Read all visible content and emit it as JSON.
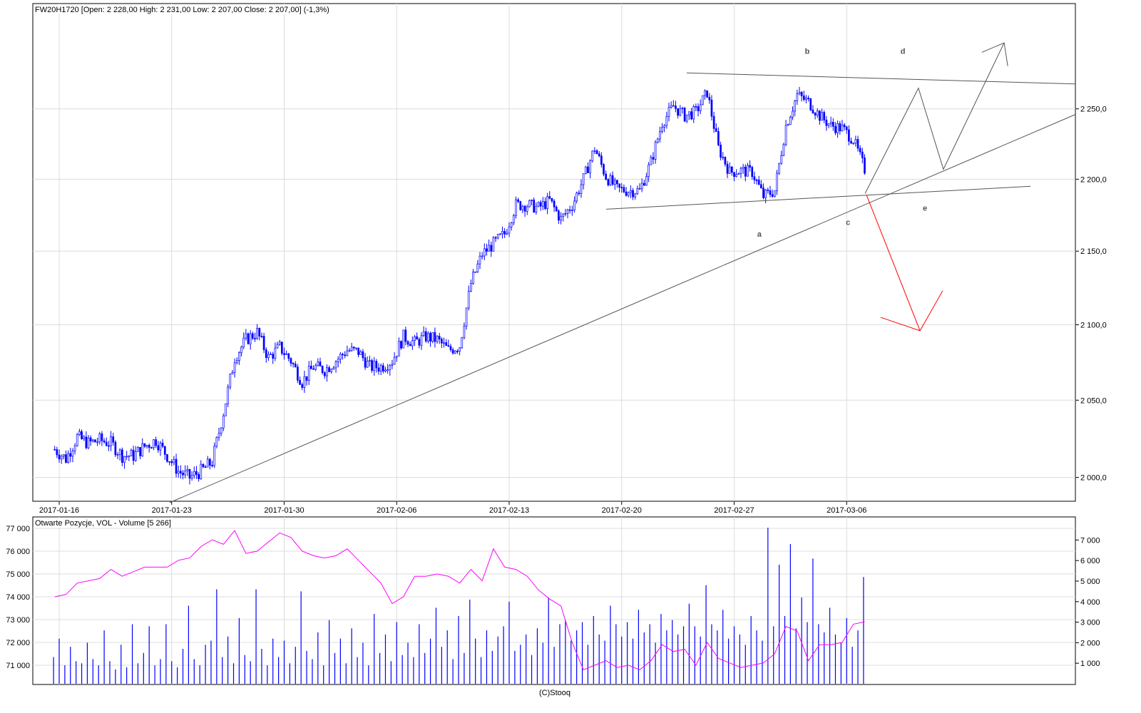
{
  "header": {
    "title": "FW20H1720 [Open: 2 228,00  High: 2 231,00  Low: 2 207,00  Close: 2 207,00] (-1,3%)"
  },
  "footer": {
    "credit": "(C)Stooq"
  },
  "colors": {
    "candle": "#0000ff",
    "volume": "#0000ff",
    "open_interest": "#ff00ff",
    "trendline": "#555555",
    "bear_arrow": "#ff0000",
    "grid": "#dcdcdc"
  },
  "chart_data": [
    {
      "type": "candlestick",
      "title": "FW20H1720 [Open: 2 228,00  High: 2 231,00  Low: 2 207,00  Close: 2 207,00] (-1,3%)",
      "x_unit": "trading days since 2017-01-16",
      "x_start": -0.2,
      "x_step": 0.5,
      "close": [
        2018,
        2012,
        2026,
        2022,
        2024,
        2022,
        2014,
        2014,
        2020,
        2024,
        2014,
        2004,
        2000,
        2004,
        2010,
        2042,
        2078,
        2090,
        2095,
        2078,
        2085,
        2076,
        2062,
        2072,
        2070,
        2076,
        2083,
        2082,
        2072,
        2072,
        2076,
        2092,
        2088,
        2092,
        2090,
        2083,
        2086,
        2128,
        2148,
        2155,
        2162,
        2182,
        2182,
        2180,
        2185,
        2172,
        2182,
        2200,
        2222,
        2202,
        2193,
        2192,
        2192,
        2212,
        2240,
        2252,
        2245,
        2248,
        2262,
        2222,
        2205,
        2206,
        2205,
        2188,
        2192,
        2238,
        2260,
        2255,
        2245,
        2238,
        2236,
        2228,
        2207
      ],
      "x_ticks": [
        {
          "day": 0,
          "label": "2017-01-16"
        },
        {
          "day": 5,
          "label": "2017-01-23"
        },
        {
          "day": 10,
          "label": "2017-01-30"
        },
        {
          "day": 15,
          "label": "2017-02-06"
        },
        {
          "day": 20,
          "label": "2017-02-13"
        },
        {
          "day": 25,
          "label": "2017-02-20"
        },
        {
          "day": 30,
          "label": "2017-02-27"
        },
        {
          "day": 35,
          "label": "2017-03-06"
        }
      ],
      "y_ticks": [
        {
          "value": 2000,
          "label": "2 000,0"
        },
        {
          "value": 2050,
          "label": "2 050,0"
        },
        {
          "value": 2100,
          "label": "2 100,0"
        },
        {
          "value": 2150,
          "label": "2 150,0"
        },
        {
          "value": 2200,
          "label": "2 200,0"
        },
        {
          "value": 2250,
          "label": "2 250,0"
        }
      ],
      "ylim": [
        1984,
        2310
      ],
      "y_scale": "log",
      "grid": true,
      "annotations": {
        "lines": [
          {
            "name": "long-support-trendline",
            "color": "trendline",
            "points": [
              [
                4.91,
                1984
              ],
              [
                45.17,
                2246
              ]
            ]
          },
          {
            "name": "upper-resistance-line",
            "color": "trendline",
            "points": [
              [
                27.89,
                2276
              ],
              [
                45.17,
                2268
              ]
            ]
          },
          {
            "name": "lower-triangle-line",
            "color": "trendline",
            "points": [
              [
                24.31,
                2179
              ],
              [
                43.17,
                2195
              ]
            ]
          },
          {
            "name": "bull-projection-path",
            "color": "trendline",
            "points": [
              [
                35.82,
                2190
              ],
              [
                38.19,
                2265
              ],
              [
                39.3,
                2207
              ],
              [
                42.0,
                2298
              ]
            ]
          },
          {
            "name": "bull-arrow-head",
            "color": "trendline",
            "points": [
              [
                41.01,
                2291
              ],
              [
                42.0,
                2298
              ],
              [
                42.16,
                2281
              ]
            ]
          },
          {
            "name": "bear-projection-path",
            "color": "bear_arrow",
            "points": [
              [
                35.88,
                2189
              ],
              [
                38.26,
                2096
              ]
            ]
          },
          {
            "name": "bear-arrow-head",
            "color": "bear_arrow",
            "points": [
              [
                36.51,
                2105
              ],
              [
                38.26,
                2096
              ],
              [
                39.27,
                2123
              ]
            ]
          }
        ],
        "labels": [
          {
            "text": "a",
            "day": 31.12,
            "price": 2162
          },
          {
            "text": "b",
            "day": 33.25,
            "price": 2292
          },
          {
            "text": "c",
            "day": 35.06,
            "price": 2170
          },
          {
            "text": "d",
            "day": 37.5,
            "price": 2292
          },
          {
            "text": "e",
            "day": 38.48,
            "price": 2180
          }
        ]
      }
    },
    {
      "type": "bar+line",
      "title": "Otwarte Pozycje, VOL - Volume [5 266]",
      "x_start": -0.25,
      "volume_step": 0.25,
      "volume": [
        1300,
        2200,
        900,
        1800,
        1100,
        1000,
        2000,
        1200,
        900,
        2600,
        1100,
        700,
        1900,
        800,
        2900,
        1000,
        1500,
        2800,
        900,
        1200,
        2900,
        1100,
        800,
        1700,
        3800,
        1200,
        900,
        1900,
        2100,
        4600,
        1300,
        2300,
        1000,
        3200,
        1400,
        1100,
        4600,
        1700,
        900,
        2200,
        1300,
        2100,
        1000,
        1800,
        4500,
        1600,
        1200,
        2500,
        900,
        3100,
        1500,
        2200,
        1000,
        2700,
        1300,
        2000,
        900,
        3400,
        1500,
        2400,
        1100,
        3000,
        1400,
        2000,
        1300,
        2900,
        1500,
        2200,
        3700,
        1800,
        2600,
        1200,
        3300,
        1500,
        4100,
        2200,
        1300,
        2600,
        1600,
        2300,
        2800,
        4000,
        1600,
        1900,
        2400,
        1400,
        2700,
        2000,
        4200,
        1800,
        2900,
        3100,
        2100,
        2600,
        3000,
        1900,
        3300,
        2400,
        2100,
        3800,
        2900,
        2300,
        3000,
        2200,
        3600,
        2500,
        2900,
        2000,
        3400,
        2600,
        3100,
        2400,
        2800,
        3900,
        2800,
        2300,
        4800,
        2900,
        2600,
        3600,
        2200,
        2800,
        2400,
        1900,
        3300,
        2600,
        2100,
        7600,
        2800,
        5800,
        3300,
        6800,
        2700,
        4200,
        3000,
        6100,
        2900,
        2500,
        3700,
        2400,
        2000,
        3200,
        1800,
        2600,
        5200
      ],
      "oi_step": 0.5,
      "open_interest": [
        74000,
        74100,
        74600,
        74700,
        74800,
        75200,
        74900,
        75100,
        75300,
        75300,
        75300,
        75600,
        75700,
        76200,
        76500,
        76300,
        76900,
        75900,
        76000,
        76400,
        76800,
        76600,
        76000,
        75800,
        75700,
        75800,
        76100,
        75600,
        75100,
        74600,
        73700,
        74000,
        74900,
        74900,
        75000,
        74900,
        74600,
        75200,
        74700,
        76100,
        75300,
        75200,
        74900,
        74300,
        73900,
        73600,
        72000,
        70800,
        71000,
        71200,
        70900,
        71000,
        70800,
        71200,
        71900,
        71600,
        71700,
        71000,
        72000,
        71300,
        71100,
        70900,
        71000,
        71100,
        71500,
        72700,
        72500,
        71200,
        71900,
        71900,
        72000,
        72800,
        72900
      ],
      "left_ticks": [
        {
          "value": 71000,
          "label": "71 000"
        },
        {
          "value": 72000,
          "label": "72 000"
        },
        {
          "value": 73000,
          "label": "73 000"
        },
        {
          "value": 74000,
          "label": "74 000"
        },
        {
          "value": 75000,
          "label": "75 000"
        },
        {
          "value": 76000,
          "label": "76 000"
        },
        {
          "value": 77000,
          "label": "77 000"
        }
      ],
      "right_ticks": [
        {
          "value": 1000,
          "label": "1 000"
        },
        {
          "value": 2000,
          "label": "2 000"
        },
        {
          "value": 3000,
          "label": "3 000"
        },
        {
          "value": 4000,
          "label": "4 000"
        },
        {
          "value": 5000,
          "label": "5 000"
        },
        {
          "value": 6000,
          "label": "6 000"
        },
        {
          "value": 7000,
          "label": "7 000"
        }
      ]
    }
  ]
}
